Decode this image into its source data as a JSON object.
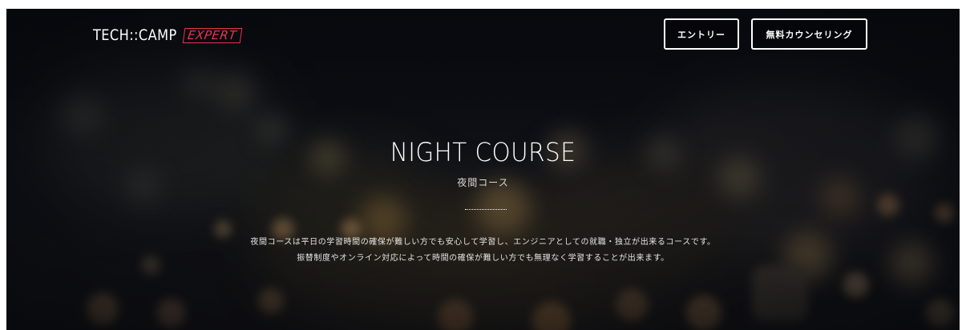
{
  "header": {
    "logo_main": "TECH::CAMP",
    "logo_accent": "EXPERT",
    "entry_label": "エントリー",
    "counseling_label": "無料カウンセリング"
  },
  "hero": {
    "title": "NIGHT COURSE",
    "subtitle": "夜間コース",
    "description_line1": "夜間コースは平日の学習時間の確保が難しい方でも安心して学習し、エンジニアとしての就職・独立が出来るコースです。",
    "description_line2": "振替制度やオンライン対応によって時間の確保が難しい方でも無理なく学習することが出来ます。"
  },
  "colors": {
    "background": "#0c0e14",
    "accent": "#e8354b",
    "text": "#ffffff"
  }
}
